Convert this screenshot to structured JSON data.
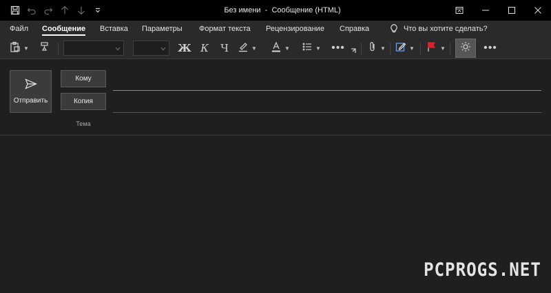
{
  "window": {
    "title": "Без имени  -  Сообщение (HTML)"
  },
  "tabs": [
    {
      "label": "Файл"
    },
    {
      "label": "Сообщение"
    },
    {
      "label": "Вставка"
    },
    {
      "label": "Параметры"
    },
    {
      "label": "Формат текста"
    },
    {
      "label": "Рецензирование"
    },
    {
      "label": "Справка"
    }
  ],
  "tell_me": {
    "label": "Что вы хотите сделать?"
  },
  "ribbon": {
    "bold": "Ж",
    "italic": "К",
    "underline": "Ч",
    "more": "•••"
  },
  "compose": {
    "send_label": "Отправить",
    "to_label": "Кому",
    "cc_label": "Копия",
    "subject_label": "Тема"
  },
  "watermark": "PCPROGS.NET"
}
